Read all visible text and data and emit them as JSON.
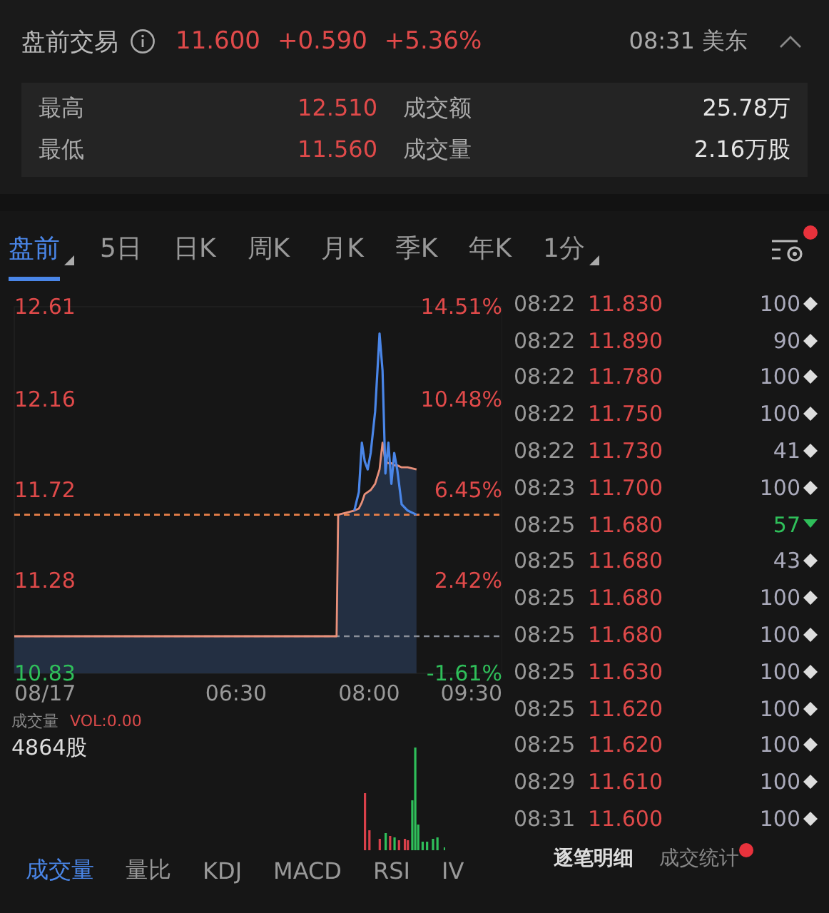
{
  "header": {
    "title": "盘前交易",
    "price": "11.600",
    "change": "+0.590",
    "change_pct": "+5.36%",
    "time": "08:31 美东",
    "expanded": true
  },
  "stats": [
    {
      "label": "最高",
      "value": "12.510",
      "kind": "price"
    },
    {
      "label": "成交额",
      "value": "25.78万",
      "kind": "amount"
    },
    {
      "label": "最低",
      "value": "11.560",
      "kind": "price"
    },
    {
      "label": "成交量",
      "value": "2.16万股",
      "kind": "amount"
    }
  ],
  "period_tabs": [
    {
      "label": "盘前",
      "selected": true,
      "dropdown": true
    },
    {
      "label": "5日",
      "selected": false,
      "dropdown": false
    },
    {
      "label": "日K",
      "selected": false,
      "dropdown": false
    },
    {
      "label": "周K",
      "selected": false,
      "dropdown": false
    },
    {
      "label": "月K",
      "selected": false,
      "dropdown": false
    },
    {
      "label": "季K",
      "selected": false,
      "dropdown": false
    },
    {
      "label": "年K",
      "selected": false,
      "dropdown": false
    },
    {
      "label": "1分",
      "selected": false,
      "dropdown": true
    }
  ],
  "settings": {
    "badge": true
  },
  "price_chart": {
    "right_labels": [
      {
        "label": "14.51%",
        "kind": "up"
      },
      {
        "label": "10.48%",
        "kind": "up"
      },
      {
        "label": "6.45%",
        "kind": "up"
      },
      {
        "label": "2.42%",
        "kind": "up"
      },
      {
        "label": "-1.61%",
        "kind": "down"
      }
    ],
    "chart_data": {
      "type": "line",
      "x": [
        4,
        7.633,
        7.65,
        7.833,
        7.883,
        7.917,
        7.95,
        7.983,
        8.017,
        8.067,
        8.117,
        8.15,
        8.183,
        8.217,
        8.25,
        8.283,
        8.317,
        8.367,
        8.433,
        8.533
      ],
      "series": [
        {
          "color": "#4a86e8",
          "values": [
            null,
            null,
            null,
            11.62,
            11.71,
            11.95,
            11.86,
            11.82,
            11.9,
            12.1,
            12.48,
            12.3,
            11.8,
            11.95,
            11.75,
            11.9,
            11.82,
            11.65,
            11.62,
            11.6
          ]
        },
        {
          "color": "#e8907a",
          "values": [
            11.01,
            11.01,
            11.6,
            11.62,
            11.63,
            11.66,
            11.7,
            11.71,
            11.72,
            11.75,
            11.82,
            11.95,
            11.86,
            11.85,
            11.85,
            11.84,
            11.84,
            11.83,
            11.83,
            11.82
          ]
        }
      ],
      "xlim": [
        4,
        9.5
      ],
      "ylim": [
        10.83,
        12.61
      ],
      "yticks": [
        10.83,
        11.28,
        11.72,
        12.16,
        12.61
      ],
      "xticks": [
        {
          "value": 4,
          "label": "08/17"
        },
        {
          "value": 6.5,
          "label": "06:30"
        },
        {
          "value": 8,
          "label": "08:00"
        },
        {
          "value": 9.5,
          "label": "09:30"
        }
      ],
      "ref_lines": [
        {
          "axis": "y",
          "value": 11.6,
          "color": "#e8804a"
        },
        {
          "axis": "y",
          "value": 11.01,
          "color": "#8a8f99"
        }
      ]
    }
  },
  "volume": {
    "label": "成交量",
    "indicator": "VOL:0.00",
    "reading": "4864股"
  },
  "indicator_tabs": [
    {
      "label": "成交量",
      "selected": true
    },
    {
      "label": "量比",
      "selected": false
    },
    {
      "label": "KDJ",
      "selected": false
    },
    {
      "label": "MACD",
      "selected": false
    },
    {
      "label": "RSI",
      "selected": false
    },
    {
      "label": "IV",
      "selected": false
    }
  ],
  "trades": [
    {
      "time": "08:22",
      "price": "11.830",
      "volume": "100",
      "kind": "neutral"
    },
    {
      "time": "08:22",
      "price": "11.890",
      "volume": "90",
      "kind": "neutral"
    },
    {
      "time": "08:22",
      "price": "11.780",
      "volume": "100",
      "kind": "neutral"
    },
    {
      "time": "08:22",
      "price": "11.750",
      "volume": "100",
      "kind": "neutral"
    },
    {
      "time": "08:22",
      "price": "11.730",
      "volume": "41",
      "kind": "neutral"
    },
    {
      "time": "08:23",
      "price": "11.700",
      "volume": "100",
      "kind": "neutral"
    },
    {
      "time": "08:25",
      "price": "11.680",
      "volume": "57",
      "kind": "sell"
    },
    {
      "time": "08:25",
      "price": "11.680",
      "volume": "43",
      "kind": "neutral"
    },
    {
      "time": "08:25",
      "price": "11.680",
      "volume": "100",
      "kind": "neutral"
    },
    {
      "time": "08:25",
      "price": "11.680",
      "volume": "100",
      "kind": "neutral"
    },
    {
      "time": "08:25",
      "price": "11.630",
      "volume": "100",
      "kind": "neutral"
    },
    {
      "time": "08:25",
      "price": "11.620",
      "volume": "100",
      "kind": "neutral"
    },
    {
      "time": "08:25",
      "price": "11.620",
      "volume": "100",
      "kind": "neutral"
    },
    {
      "time": "08:29",
      "price": "11.610",
      "volume": "100",
      "kind": "neutral"
    },
    {
      "time": "08:31",
      "price": "11.600",
      "volume": "100",
      "kind": "neutral"
    }
  ],
  "trade_tabs": [
    {
      "label": "逐笔明细",
      "selected": true,
      "badge": false
    },
    {
      "label": "成交统计",
      "selected": false,
      "badge": true
    }
  ]
}
